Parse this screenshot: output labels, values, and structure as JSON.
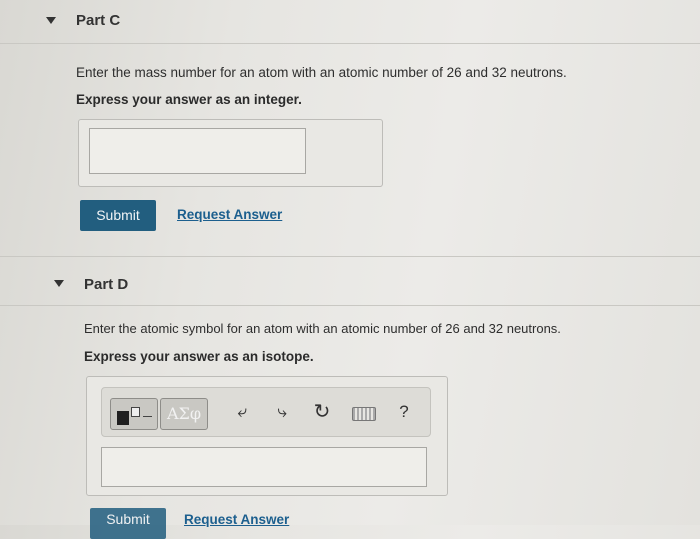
{
  "part_c": {
    "title": "Part C",
    "prompt": "Enter the mass number for an atom with an atomic number of 26 and 32 neutrons.",
    "instruction": "Express your answer as an integer.",
    "answer_value": "",
    "submit_label": "Submit",
    "request_answer_label": "Request Answer"
  },
  "part_d": {
    "title": "Part D",
    "prompt": "Enter the atomic symbol for an atom with an atomic number of 26 and 32 neutrons.",
    "instruction": "Express your answer as an isotope.",
    "toolbar": {
      "greek_label": "ΑΣφ",
      "help_label": "?"
    },
    "answer_value": "",
    "submit_label": "Submit",
    "request_answer_label": "Request Answer"
  },
  "colors": {
    "submit_bg": "#225e7f",
    "link": "#1c5f8e"
  },
  "icons": [
    "caret-down-icon",
    "template-icon",
    "undo-icon",
    "redo-icon",
    "reset-icon",
    "keyboard-icon",
    "help-icon"
  ]
}
